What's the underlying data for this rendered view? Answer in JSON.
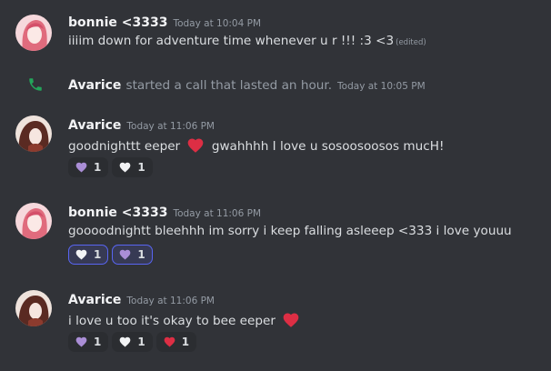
{
  "colors": {
    "background": "#313338",
    "call_icon": "#23a55a",
    "heart_purple": "#aa8ed6",
    "heart_white": "#f2f3f5",
    "heart_red": "#dd2e44",
    "reaction_me_border": "#5865f2"
  },
  "messages": [
    {
      "author": "bonnie <3333",
      "timestamp": "Today at 10:04 PM",
      "text": "iiiim down for adventure time whenever u r  !!! :3 <3",
      "edited": "(edited)"
    },
    {
      "system": true,
      "icon": "phone-icon",
      "author": "Avarice",
      "text": "started a call that lasted an hour.",
      "timestamp": "Today at 10:05 PM"
    },
    {
      "author": "Avarice",
      "timestamp": "Today at 11:06 PM",
      "text_before": "goodnighttt eeper",
      "inline_emoji": "red-heart-icon",
      "text_after": "gwahhhh I love u sosoosoosos mucH!",
      "reactions": [
        {
          "emoji": "purple-heart-icon",
          "count": "1",
          "me": false
        },
        {
          "emoji": "white-heart-icon",
          "count": "1",
          "me": false
        }
      ]
    },
    {
      "author": "bonnie <3333",
      "timestamp": "Today at 11:06 PM",
      "text": "goooodnightt bleehhh im sorry i keep falling asleeep <333 i love youuu",
      "reactions": [
        {
          "emoji": "white-heart-icon",
          "count": "1",
          "me": true
        },
        {
          "emoji": "purple-heart-icon",
          "count": "1",
          "me": true
        }
      ]
    },
    {
      "author": "Avarice",
      "timestamp": "Today at 11:06 PM",
      "text_before": "i love u too it's okay to bee eeper",
      "inline_emoji": "red-heart-icon",
      "reactions": [
        {
          "emoji": "purple-heart-icon",
          "count": "1",
          "me": false
        },
        {
          "emoji": "white-heart-icon",
          "count": "1",
          "me": false
        },
        {
          "emoji": "red-heart-icon",
          "count": "1",
          "me": false
        }
      ]
    }
  ]
}
